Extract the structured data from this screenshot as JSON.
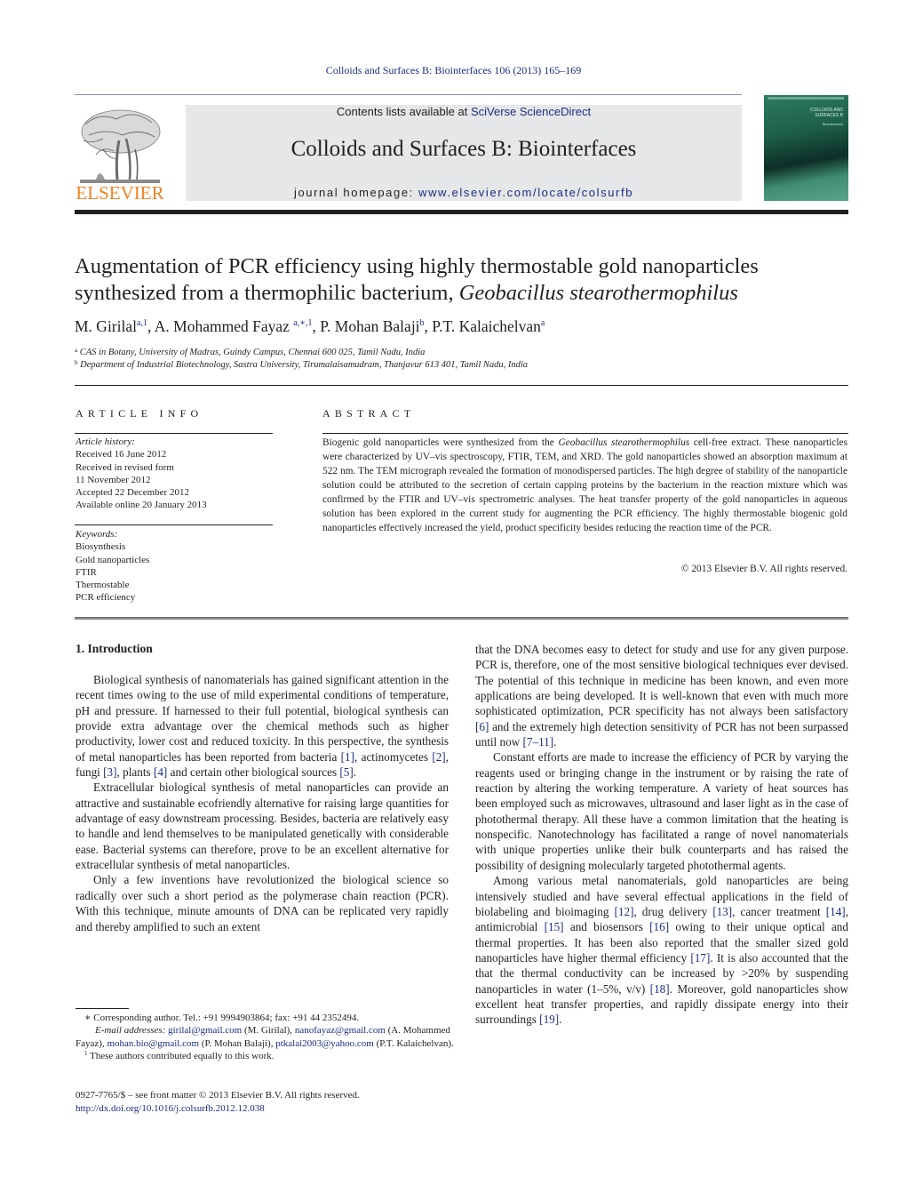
{
  "header": {
    "running_head": "Colloids and Surfaces B: Biointerfaces 106 (2013) 165–169",
    "publisher_logo_text": "ELSEVIER",
    "contents_prefix": "Contents lists available at ",
    "contents_link": "SciVerse ScienceDirect",
    "journal_title": "Colloids and Surfaces B: Biointerfaces",
    "homepage_prefix": "journal homepage: ",
    "homepage_link": "www.elsevier.com/locate/colsurfb",
    "cover": {
      "title_line1": "COLLOIDS AND",
      "title_line2": "SURFACES B",
      "subtitle": "Biointerfaces"
    },
    "colors": {
      "link": "#1b2d83",
      "elsevier_orange": "#f08223",
      "masthead_bg": "#e6e7e8",
      "cover_green": "#1d5f4b"
    }
  },
  "article": {
    "title_line1": "Augmentation of PCR efficiency using highly thermostable gold nanoparticles",
    "title_line2_plain": "synthesized from a thermophilic bacterium, ",
    "title_line2_italic": "Geobacillus stearothermophilus",
    "authors": [
      {
        "name": "M. Girilal",
        "marks": "a,1"
      },
      {
        "name": "A. Mohammed Fayaz",
        "marks": "a,∗,1"
      },
      {
        "name": "P. Mohan Balaji",
        "marks": "b"
      },
      {
        "name": "P.T. Kalaichelvan",
        "marks": "a"
      }
    ],
    "affiliations": [
      {
        "mark": "a",
        "text": "CAS in Botany, University of Madras, Guindy Campus, Chennai 600 025, Tamil Nadu, India"
      },
      {
        "mark": "b",
        "text": "Department of Industrial Biotechnology, Sastra University, Tirumalaisamudram, Thanjavur 613 401, Tamil Nadu, India"
      }
    ]
  },
  "article_info": {
    "heading": "ARTICLE INFO",
    "history_label": "Article history:",
    "history": [
      "Received 16 June 2012",
      "Received in revised form",
      "11 November 2012",
      "Accepted 22 December 2012",
      "Available online 20 January 2013"
    ],
    "keywords_label": "Keywords:",
    "keywords": [
      "Biosynthesis",
      "Gold nanoparticles",
      "FTIR",
      "Thermostable",
      "PCR efficiency"
    ]
  },
  "abstract": {
    "heading": "ABSTRACT",
    "text_start": "Biogenic gold nanoparticles were synthesized from the ",
    "text_italic": "Geobacillus stearothermophilus",
    "text_rest": " cell-free extract. These nanoparticles were characterized by UV–vis spectroscopy, FTIR, TEM, and XRD. The gold nanoparticles showed an absorption maximum at 522 nm. The TEM micrograph revealed the formation of monodispersed particles. The high degree of stability of the nanoparticle solution could be attributed to the secretion of certain capping proteins by the bacterium in the reaction mixture which was confirmed by the FTIR and UV–vis spectrometric analyses. The heat transfer property of the gold nanoparticles in aqueous solution has been explored in the current study for augmenting the PCR efficiency. The highly thermostable biogenic gold nanoparticles effectively increased the yield, product specificity besides reducing the reaction time of the PCR.",
    "copyright": "© 2013 Elsevier B.V. All rights reserved."
  },
  "introduction": {
    "heading": "1.  Introduction",
    "left_column": [
      {
        "segments": [
          {
            "t": "Biological synthesis of nanomaterials has gained significant attention in the recent times owing to the use of mild experimental conditions of temperature, pH and pressure. If harnessed to their full potential, biological synthesis can provide extra advantage over the chemical methods such as higher productivity, lower cost and reduced toxicity. In this perspective, the synthesis of metal nanoparticles has been reported from bacteria "
          },
          {
            "ref": "[1]"
          },
          {
            "t": ", actinomycetes "
          },
          {
            "ref": "[2]"
          },
          {
            "t": ", fungi "
          },
          {
            "ref": "[3]"
          },
          {
            "t": ", plants "
          },
          {
            "ref": "[4]"
          },
          {
            "t": " and certain other biological sources "
          },
          {
            "ref": "[5]"
          },
          {
            "t": "."
          }
        ]
      },
      {
        "segments": [
          {
            "t": "Extracellular biological synthesis of metal nanoparticles can provide an attractive and sustainable ecofriendly alternative for raising large quantities for advantage of easy downstream processing. Besides, bacteria are relatively easy to handle and lend themselves to be manipulated genetically with considerable ease. Bacterial systems can therefore, prove to be an excellent alternative for extracellular synthesis of metal nanoparticles."
          }
        ]
      },
      {
        "segments": [
          {
            "t": "Only a few inventions have revolutionized the biological science so radically over such a short period as the polymerase chain reaction (PCR). With this technique, minute amounts of DNA can be replicated very rapidly and thereby amplified to such an extent"
          }
        ]
      }
    ],
    "right_column": [
      {
        "noindent": true,
        "segments": [
          {
            "t": "that the DNA becomes easy to detect for study and use for any given purpose. PCR is, therefore, one of the most sensitive biological techniques ever devised. The potential of this technique in medicine has been known, and even more applications are being developed. It is well-known that even with much more sophisticated optimization, PCR specificity has not always been satisfactory "
          },
          {
            "ref": "[6]"
          },
          {
            "t": " and the extremely high detection sensitivity of PCR has not been surpassed until now "
          },
          {
            "ref": "[7–11]"
          },
          {
            "t": "."
          }
        ]
      },
      {
        "segments": [
          {
            "t": "Constant efforts are made to increase the efficiency of PCR by varying the reagents used or bringing change in the instrument or by raising the rate of reaction by altering the working temperature. A variety of heat sources has been employed such as microwaves, ultrasound and laser light as in the case of photothermal therapy. All these have a common limitation that the heating is nonspecific. Nanotechnology has facilitated a range of novel nanomaterials with unique properties unlike their bulk counterparts and has raised the possibility of designing molecularly targeted photothermal agents."
          }
        ]
      },
      {
        "segments": [
          {
            "t": "Among various metal nanomaterials, gold nanoparticles are being intensively studied and have several effectual applications in the field of biolabeling and bioimaging "
          },
          {
            "ref": "[12]"
          },
          {
            "t": ", drug delivery "
          },
          {
            "ref": "[13]"
          },
          {
            "t": ", cancer treatment "
          },
          {
            "ref": "[14]"
          },
          {
            "t": ", antimicrobial "
          },
          {
            "ref": "[15]"
          },
          {
            "t": " and biosensors "
          },
          {
            "ref": "[16]"
          },
          {
            "t": " owing to their unique optical and thermal properties. It has been also reported that the smaller sized gold nanoparticles have higher thermal efficiency "
          },
          {
            "ref": "[17]"
          },
          {
            "t": ". It is also accounted that the that the thermal conductivity can be increased by >20% by suspending nanoparticles in water (1–5%, v/v) "
          },
          {
            "ref": "[18]"
          },
          {
            "t": ". Moreover, gold nanoparticles show excellent heat transfer properties, and rapidly dissipate energy into their surroundings "
          },
          {
            "ref": "[19]"
          },
          {
            "t": "."
          }
        ]
      }
    ]
  },
  "footnotes": {
    "corresponding": "∗  Corresponding author. Tel.: +91 9994903864; fax: +91 44 2352494.",
    "email_label": "E-mail addresses:",
    "emails": [
      {
        "addr": "girilal@gmail.com",
        "who": " (M. Girilal), "
      },
      {
        "addr": "nanofayaz@gmail.com",
        "who": " (A. Mohammed Fayaz), "
      },
      {
        "addr": "mohan.bio@gmail.com",
        "who": " (P. Mohan Balaji), "
      },
      {
        "addr": "ptkalai2003@yahoo.com",
        "who": " (P.T. Kalaichelvan)."
      }
    ],
    "equal_mark": "1",
    "equal_text": " These authors contributed equally to this work."
  },
  "front_matter": {
    "issn_line": "0927-7765/$ – see front matter © 2013 Elsevier B.V. All rights reserved.",
    "doi": "http://dx.doi.org/10.1016/j.colsurfb.2012.12.038"
  }
}
